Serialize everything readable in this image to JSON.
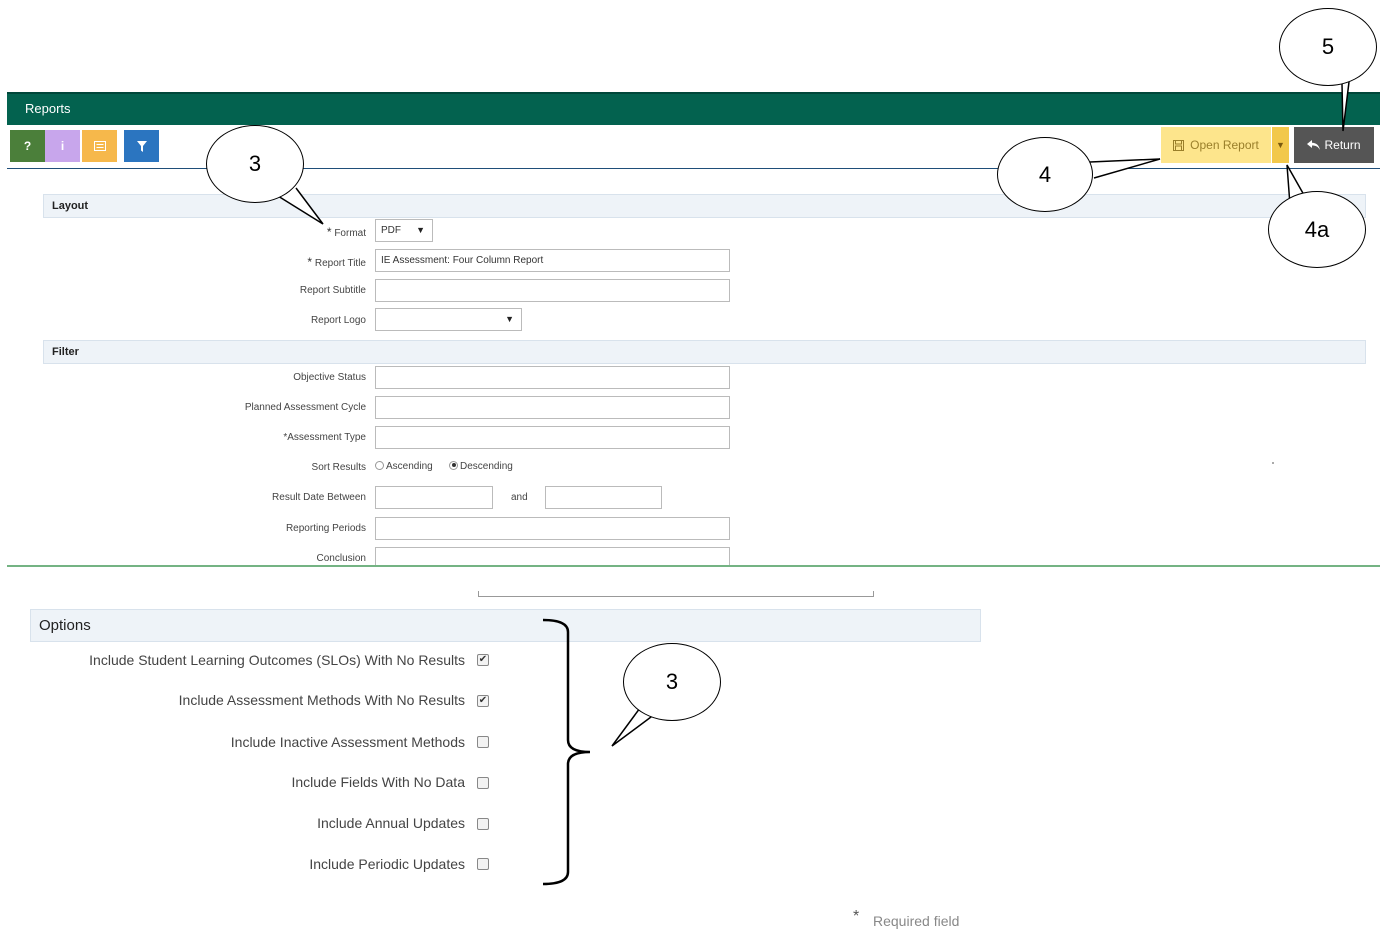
{
  "header": {
    "title": "Reports"
  },
  "toolbar": {
    "help_label": "?",
    "info_label": "i",
    "open_report_label": "Open Report",
    "return_label": "Return",
    "colors": {
      "help": "#4b7f3a",
      "info": "#c8a6ec",
      "list": "#f6b84b",
      "filter": "#2b75c0"
    }
  },
  "layout": {
    "section_title": "Layout",
    "format_label": "Format",
    "format_value": "PDF",
    "report_title_label": "Report Title",
    "report_title_value": "IE Assessment: Four Column Report",
    "report_subtitle_label": "Report Subtitle",
    "report_logo_label": "Report Logo"
  },
  "filter": {
    "section_title": "Filter",
    "objective_status_label": "Objective Status",
    "planned_cycle_label": "Planned Assessment Cycle",
    "assessment_type_label": "*Assessment Type",
    "sort_results_label": "Sort Results",
    "ascending_label": "Ascending",
    "descending_label": "Descending",
    "result_date_label": "Result Date Between",
    "and_label": "and",
    "reporting_periods_label": "Reporting Periods",
    "conclusion_label": "Conclusion"
  },
  "options": {
    "section_title": "Options",
    "items": [
      {
        "label": "Include Student Learning Outcomes (SLOs) With No Results",
        "checked": true
      },
      {
        "label": "Include Assessment Methods With No Results",
        "checked": true
      },
      {
        "label": "Include Inactive Assessment Methods",
        "checked": false
      },
      {
        "label": "Include Fields With No Data",
        "checked": false
      },
      {
        "label": "Include Annual Updates",
        "checked": false
      },
      {
        "label": "Include Periodic Updates",
        "checked": false
      }
    ],
    "required_star": "*",
    "required_text": "Required field"
  },
  "callouts": {
    "c5": "5",
    "c3_top": "3",
    "c4": "4",
    "c4a": "4a",
    "c3_bottom": "3"
  }
}
